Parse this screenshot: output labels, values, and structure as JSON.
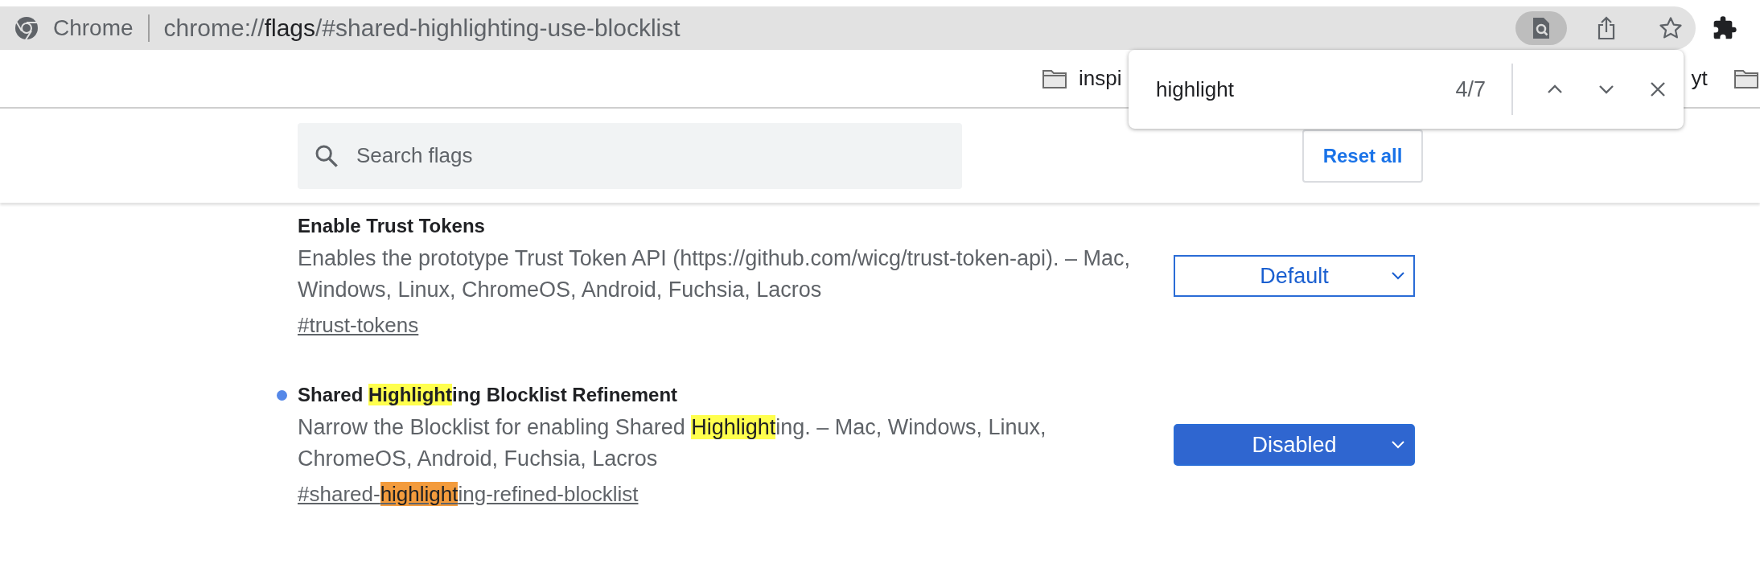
{
  "address_bar": {
    "site_label": "Chrome",
    "url": [
      {
        "text": "chrome://",
        "emphasis": false
      },
      {
        "text": "flags",
        "emphasis": true
      },
      {
        "text": "/#shared-highlighting-use-blocklist",
        "emphasis": false
      }
    ],
    "find_active": true
  },
  "bookmarks": [
    {
      "label": "inspi",
      "icon_shown": true
    },
    {
      "label": "yt",
      "icon_shown": false
    },
    {
      "icon_shown": true
    }
  ],
  "find_bar": {
    "query": "highlight",
    "count": "4/7"
  },
  "search": {
    "placeholder": "Search flags"
  },
  "reset_button": "Reset all",
  "flags": [
    {
      "modified": false,
      "title": [
        {
          "text": "Enable Trust Tokens"
        }
      ],
      "description": [
        {
          "text": "Enables the prototype Trust Token API (https://github.com/wicg/trust-token-api). – Mac, Windows, Linux, ChromeOS, Android, Fuchsia, Lacros"
        }
      ],
      "link": [
        {
          "text": "#trust-tokens"
        }
      ],
      "value": "Default"
    },
    {
      "modified": true,
      "title": [
        {
          "text": "Shared "
        },
        {
          "text": "Highlight",
          "highlighted": true,
          "current": false
        },
        {
          "text": "ing Blocklist Refinement"
        }
      ],
      "description": [
        {
          "text": "Narrow the Blocklist for enabling Shared "
        },
        {
          "text": "Highlight",
          "highlighted": true,
          "current": false
        },
        {
          "text": "ing. – Mac, Windows, Linux, ChromeOS, Android, Fuchsia, Lacros"
        }
      ],
      "link": [
        {
          "text": "#shared-"
        },
        {
          "text": "highlight",
          "highlighted": true,
          "current": true
        },
        {
          "text": "ing-refined-blocklist"
        }
      ],
      "value": "Disabled"
    }
  ]
}
